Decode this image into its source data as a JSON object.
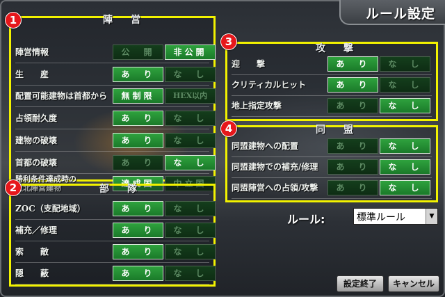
{
  "header": {
    "title": "ルール設定"
  },
  "sections": [
    {
      "badge": "1",
      "title": "陣　営",
      "rows": [
        {
          "label": "陣営情報",
          "options": [
            "公　開",
            "非公開"
          ],
          "selected": 1
        },
        {
          "label": "生　　産",
          "options": [
            "あ　り",
            "な　し"
          ],
          "selected": 0
        },
        {
          "label": "配置可能建物は首都から",
          "options": [
            "無制限",
            "HEX以内"
          ],
          "selected": 0
        },
        {
          "label": "占領耐久度",
          "options": [
            "あ　り",
            "な　し"
          ],
          "selected": 0
        },
        {
          "label": "建物の破壊",
          "options": [
            "あ　り",
            "な　し"
          ],
          "selected": 0
        },
        {
          "label": "首都の破壊",
          "options": [
            "あ　り",
            "な　し"
          ],
          "selected": 1
        },
        {
          "label": "勝利条件達成時の\n敗北陣営建物",
          "options": [
            "達成国",
            "中立国"
          ],
          "selected": 0
        }
      ]
    },
    {
      "badge": "2",
      "title": "部　隊",
      "rows": [
        {
          "label": "ZOC（支配地域）",
          "options": [
            "あ　り",
            "な　し"
          ],
          "selected": 0
        },
        {
          "label": "補充／修理",
          "options": [
            "あ　り",
            "な　し"
          ],
          "selected": 0
        },
        {
          "label": "索　　敵",
          "options": [
            "あ　り",
            "な　し"
          ],
          "selected": 0
        },
        {
          "label": "隠　　蔽",
          "options": [
            "あ　り",
            "な　し"
          ],
          "selected": 0
        }
      ]
    },
    {
      "badge": "3",
      "title": "攻　撃",
      "rows": [
        {
          "label": "迎　　撃",
          "options": [
            "あ　り",
            "な　し"
          ],
          "selected": 0
        },
        {
          "label": "クリティカルヒット",
          "options": [
            "あ　り",
            "な　し"
          ],
          "selected": 0
        },
        {
          "label": "地上指定攻撃",
          "options": [
            "あ　り",
            "な　し"
          ],
          "selected": 1
        }
      ]
    },
    {
      "badge": "4",
      "title": "同　盟",
      "rows": [
        {
          "label": "同盟建物への配置",
          "options": [
            "あ　り",
            "な　し"
          ],
          "selected": 1
        },
        {
          "label": "同盟建物での補充/修理",
          "options": [
            "あ　り",
            "な　し"
          ],
          "selected": 1
        },
        {
          "label": "同盟陣営への占領/攻撃",
          "options": [
            "あ　り",
            "な　し"
          ],
          "selected": 1
        }
      ]
    }
  ],
  "rule": {
    "label": "ルール:",
    "value": "標準ルール"
  },
  "footer": {
    "finish": "設定終了",
    "cancel": "キャンセル"
  },
  "colors": {
    "highlight": "#f2f200",
    "badge": "#e6171b",
    "on": "#2fa23e",
    "off": "#143e1c"
  }
}
